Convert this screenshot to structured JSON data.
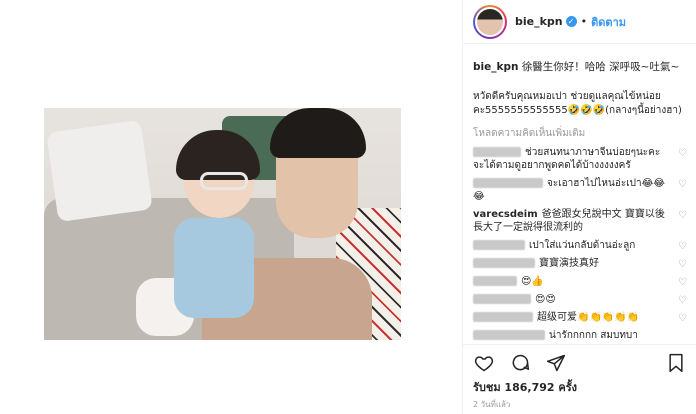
{
  "post": {
    "username": "bie_kpn",
    "follow_label": "ติดตาม",
    "separator": "•",
    "caption_user": "bie_kpn",
    "caption_text": "徐醫生你好！哈哈 深呼吸~吐氣~",
    "reply_text": "หวัดดีครับคุณหมอเปา ช่วยดูแลคุณไข้หน่อยคะ5555555555555🤣🤣🤣(กลางๆนี้อย่างฮา)",
    "load_more": "โหลดความคิดเห็นเพิ่มเติม"
  },
  "comments": [
    {
      "user": "",
      "text": "ช่วยสนทนาภาษาจีนบ่อยๆนะคะ จะได้ตามดูอยากพูดคดได้บ้างงงงงครั"
    },
    {
      "user": "",
      "text": "จะเอาฮาไปไหนอ่ะเปา😂😂😂"
    },
    {
      "user": "varecsdeim",
      "text": "爸爸跟女兒說中文 寶寶以後長大了一定說得很流利的"
    },
    {
      "user": "",
      "text": "เปาใส่แว่นกลับด้านอ่ะลูก"
    },
    {
      "user": "",
      "text": "寶寶演技真好"
    },
    {
      "user": "",
      "text": "😍👍"
    },
    {
      "user": "",
      "text": "😍😍"
    },
    {
      "user": "",
      "text": "超级可爱👏👏👏👏👏"
    },
    {
      "user": "",
      "text": "น่ารักกกกก สมบทบา"
    }
  ],
  "footer": {
    "likes_text": "รับชม 186,792 ครั้ง",
    "timestamp": "2 วันที่แล้ว"
  },
  "icons": {
    "verified": "verified-badge-icon",
    "like": "heart-icon",
    "comment": "comment-bubble-icon",
    "share": "share-icon",
    "save": "bookmark-icon"
  },
  "colors": {
    "accent": "#3897f0",
    "text": "#262626",
    "muted": "#999999"
  }
}
